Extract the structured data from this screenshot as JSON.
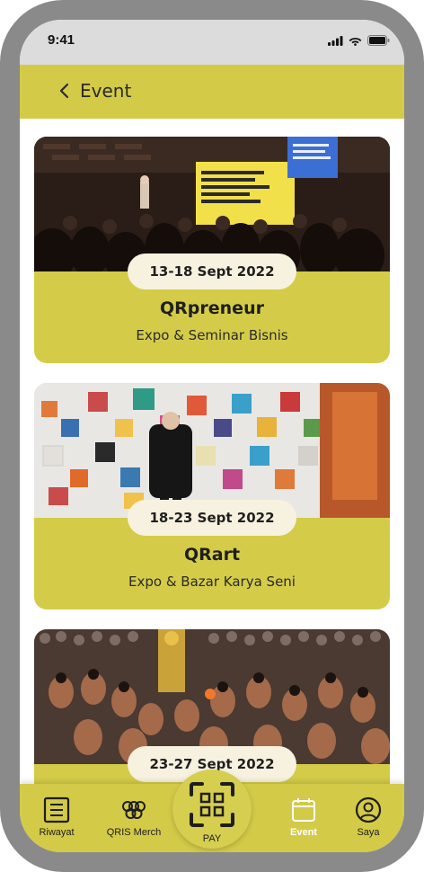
{
  "status_bar": {
    "time": "9:41"
  },
  "header": {
    "title": "Event"
  },
  "events": [
    {
      "date": "13-18 Sept 2022",
      "title": "QRpreneur",
      "subtitle": "Expo & Seminar Bisnis"
    },
    {
      "date": "18-23 Sept 2022",
      "title": "QRart",
      "subtitle": "Expo & Bazar Karya Seni"
    },
    {
      "date": "23-27 Sept 2022",
      "title": "",
      "subtitle": ""
    }
  ],
  "tabbar": {
    "riwayat": "Riwayat",
    "merch": "QRIS Merch",
    "pay": "PAY",
    "event": "Event",
    "saya": "Saya"
  },
  "colors": {
    "accent": "#d3ca48",
    "pill": "#f7f2df",
    "frame": "#8a8a8a"
  }
}
